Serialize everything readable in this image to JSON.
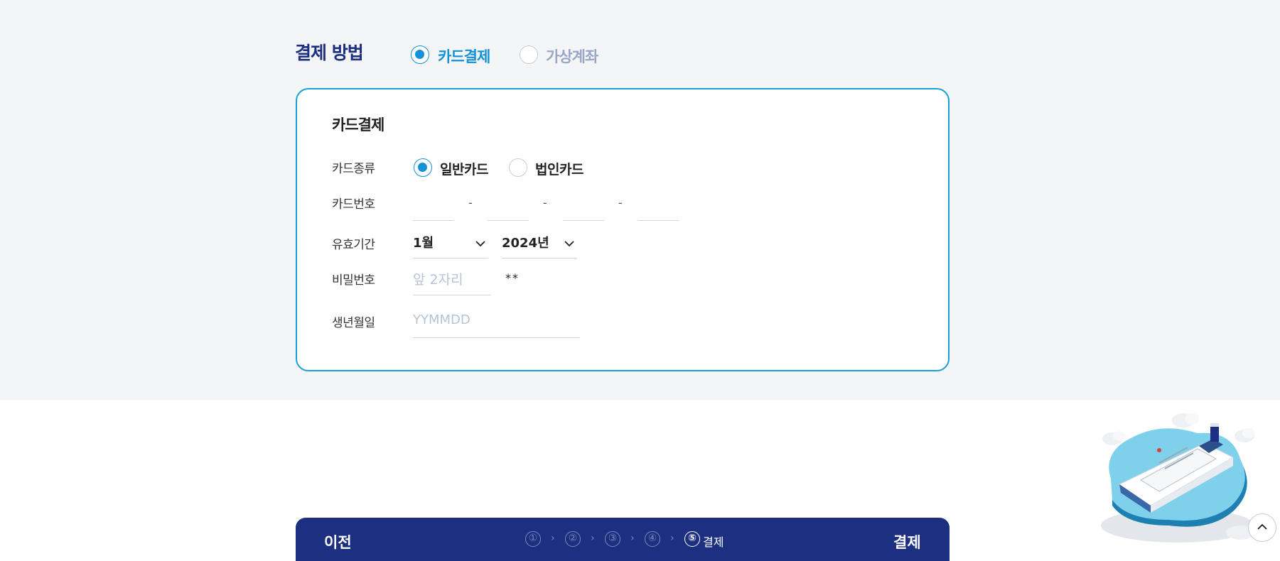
{
  "payment": {
    "section_title": "결제 방법",
    "methods": [
      {
        "label": "카드결제",
        "selected": true
      },
      {
        "label": "가상계좌",
        "selected": false
      }
    ]
  },
  "card_form": {
    "title": "카드결제",
    "labels": {
      "card_type": "카드종류",
      "card_number": "카드번호",
      "expiry": "유효기간",
      "password": "비밀번호",
      "birth": "생년월일"
    },
    "card_types": [
      {
        "label": "일반카드",
        "selected": true
      },
      {
        "label": "법인카드",
        "selected": false
      }
    ],
    "card_number_separator": "-",
    "expiry_month": "1월",
    "expiry_year": "2024년",
    "password_placeholder": "앞 2자리",
    "password_mask": "**",
    "birth_placeholder": "YYMMDD"
  },
  "bottom_bar": {
    "prev_label": "이전",
    "pay_label": "결제",
    "steps": [
      "①",
      "②",
      "③",
      "④",
      "⑤"
    ],
    "separator": "›",
    "current_step_label": "결제"
  },
  "colors": {
    "accent": "#1591d8",
    "navy": "#1d2f80",
    "border": "#18a0dc",
    "background": "#f4f5f7"
  },
  "icons": [
    "radio-checked-icon",
    "radio-unchecked-icon",
    "chevron-down-icon",
    "chevron-up-icon",
    "cruise-ship-illustration"
  ]
}
